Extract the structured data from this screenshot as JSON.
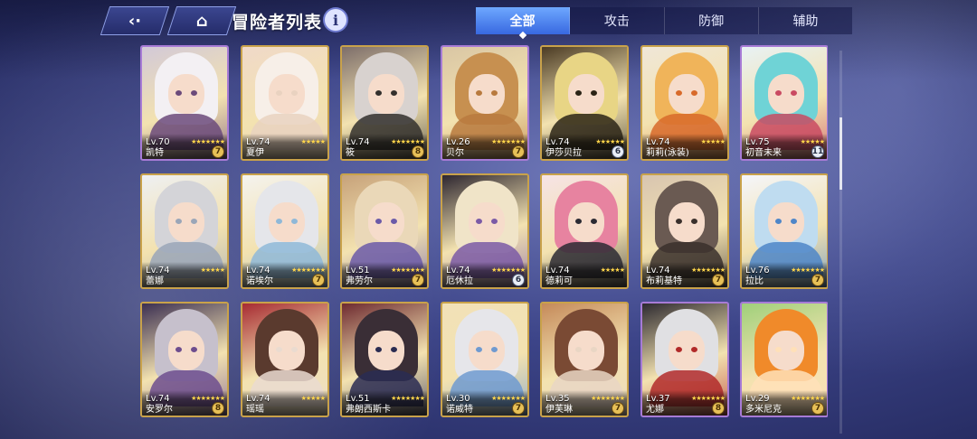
{
  "header": {
    "back_icon": "back-icon",
    "home_icon": "home-icon",
    "title": "冒险者列表",
    "info_icon": "info-icon",
    "info_glyph": "i"
  },
  "tabs": [
    {
      "label": "全部",
      "active": true
    },
    {
      "label": "攻击",
      "active": false
    },
    {
      "label": "防御",
      "active": false
    },
    {
      "label": "辅助",
      "active": false
    }
  ],
  "cards": [
    {
      "level": "Lv.70",
      "name": "凯特",
      "stars": "★★★★★★★",
      "badge": "7",
      "palette": [
        "#f3f0f3",
        "#d2c9d8",
        "#6b4a7a"
      ],
      "frame": "purple",
      "badge_style": "gold"
    },
    {
      "level": "Lv.74",
      "name": "夏伊",
      "stars": "★★★★★",
      "badge": "",
      "palette": [
        "#f7efe8",
        "#f0d9c9",
        "#e9d2c0"
      ],
      "frame": "gold",
      "badge_style": "gold"
    },
    {
      "level": "Lv.74",
      "name": "筱",
      "stars": "★★★★★★★",
      "badge": "8",
      "palette": [
        "#d8d2cf",
        "#7d6e6a",
        "#33302d"
      ],
      "frame": "gold",
      "badge_style": "gold"
    },
    {
      "level": "Lv.26",
      "name": "贝尔",
      "stars": "★★★★★★★",
      "badge": "7",
      "palette": [
        "#c79050",
        "#d9c6a4",
        "#b87a3e"
      ],
      "frame": "purple",
      "badge_style": "gold"
    },
    {
      "level": "Lv.74",
      "name": "伊莎贝拉",
      "stars": "★★★★★★",
      "badge": "6",
      "palette": [
        "#e8d585",
        "#4b3b24",
        "#2b2416"
      ],
      "frame": "gold",
      "badge_style": "silver"
    },
    {
      "level": "Lv.74",
      "name": "莉莉(泳装)",
      "stars": "★★★★★",
      "badge": "",
      "palette": [
        "#f0b45a",
        "#f0e7d8",
        "#d86a2a"
      ],
      "frame": "gold",
      "badge_style": "gold"
    },
    {
      "level": "Lv.75",
      "name": "初音未来",
      "stars": "★★★★★",
      "badge": "11",
      "palette": [
        "#6fd3d6",
        "#e8f2f5",
        "#c94a62"
      ],
      "frame": "purple",
      "badge_style": "silver"
    },
    {
      "level": "Lv.74",
      "name": "蕾娜",
      "stars": "★★★★★",
      "badge": "",
      "palette": [
        "#d4d4d8",
        "#eef0f3",
        "#9aa6b8"
      ],
      "frame": "gold",
      "badge_style": "gold"
    },
    {
      "level": "Lv.74",
      "name": "诺埃尔",
      "stars": "★★★★★★★",
      "badge": "7",
      "palette": [
        "#e5e6ea",
        "#f4f3ef",
        "#8fb8d8"
      ],
      "frame": "gold",
      "badge_style": "gold"
    },
    {
      "level": "Lv.51",
      "name": "弗劳尔",
      "stars": "★★★★★★★",
      "badge": "7",
      "palette": [
        "#ead8b8",
        "#c7a27a",
        "#6b5aa8"
      ],
      "frame": "gold",
      "badge_style": "gold"
    },
    {
      "level": "Lv.74",
      "name": "厄休拉",
      "stars": "★★★★★★★",
      "badge": "6",
      "palette": [
        "#f0e4c8",
        "#2d2630",
        "#7b5aa6"
      ],
      "frame": "gold",
      "badge_style": "silver"
    },
    {
      "level": "Lv.74",
      "name": "德莉可",
      "stars": "★★★★★",
      "badge": "",
      "palette": [
        "#e783a0",
        "#f6e3e6",
        "#2b2a33"
      ],
      "frame": "gold",
      "badge_style": "gold"
    },
    {
      "level": "Lv.74",
      "name": "布莉基特",
      "stars": "★★★★★★★",
      "badge": "7",
      "palette": [
        "#6a5a52",
        "#d8c5b0",
        "#3a302c"
      ],
      "frame": "gold",
      "badge_style": "gold"
    },
    {
      "level": "Lv.76",
      "name": "拉比",
      "stars": "★★★★★★★",
      "badge": "7",
      "palette": [
        "#bfdcf0",
        "#f4f6fb",
        "#4e86c8"
      ],
      "frame": "gold",
      "badge_style": "gold"
    },
    {
      "level": "Lv.74",
      "name": "安罗尔",
      "stars": "★★★★★★★",
      "badge": "8",
      "palette": [
        "#c6c0cc",
        "#3b2f52",
        "#6d4d8e"
      ],
      "frame": "gold",
      "badge_style": "gold"
    },
    {
      "level": "Lv.74",
      "name": "瑶瑶",
      "stars": "★★★★★",
      "badge": "",
      "palette": [
        "#5a3a2e",
        "#a72b32",
        "#eadbd0"
      ],
      "frame": "gold",
      "badge_style": "gold"
    },
    {
      "level": "Lv.51",
      "name": "弗朗西斯卡",
      "stars": "★★★★★★★",
      "badge": "",
      "palette": [
        "#3a2e36",
        "#6e2a30",
        "#2a2c52"
      ],
      "frame": "gold",
      "badge_style": "gold"
    },
    {
      "level": "Lv.30",
      "name": "诺威特",
      "stars": "★★★★★★★",
      "badge": "7",
      "palette": [
        "#e6e6ea",
        "#f2e1b8",
        "#6f9ad0"
      ],
      "frame": "gold",
      "badge_style": "gold"
    },
    {
      "level": "Lv.35",
      "name": "伊芙琳",
      "stars": "★★★★★★★",
      "badge": "7",
      "palette": [
        "#7a4a34",
        "#c58a5a",
        "#e9d6c4"
      ],
      "frame": "gold",
      "badge_style": "gold"
    },
    {
      "level": "Lv.37",
      "name": "尤娜",
      "stars": "★★★★★★★",
      "badge": "8",
      "palette": [
        "#e0e0e3",
        "#2d2a30",
        "#b12a2a"
      ],
      "frame": "purple",
      "badge_style": "gold"
    },
    {
      "level": "Lv.29",
      "name": "多米尼克",
      "stars": "★★★★★★★",
      "badge": "7",
      "palette": [
        "#f08a2a",
        "#9fd07a",
        "#ffe0b8"
      ],
      "frame": "purple",
      "badge_style": "gold"
    }
  ],
  "colors": {
    "accent_blue": "#3868e0",
    "gold_frame": "#c9a24a",
    "purple_frame": "#a77bd6",
    "star": "#ffd54a"
  }
}
